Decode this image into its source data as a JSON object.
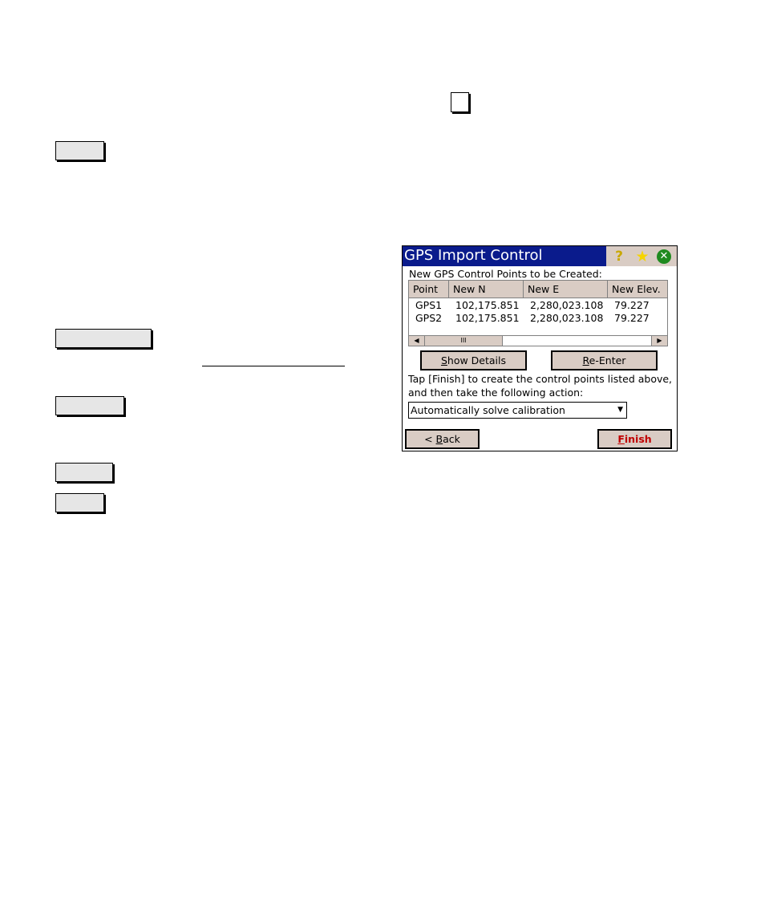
{
  "dialog": {
    "title": "GPS Import Control",
    "icons": [
      "help-icon",
      "favorites-star-icon",
      "close-icon"
    ],
    "colors": {
      "titlebar": "#0a1b8c",
      "button_face": "#d9ccc4",
      "finish_text": "#c00000"
    },
    "section_label": "New GPS Control Points to be Created:",
    "table": {
      "columns": [
        "Point",
        "New N",
        "New E",
        "New Elev."
      ],
      "rows": [
        [
          "GPS1",
          "102,175.851",
          "2,280,023.108",
          "79.227"
        ],
        [
          "GPS2",
          "102,175.851",
          "2,280,023.108",
          "79.227"
        ]
      ],
      "scrollbar": {
        "left_arrow": "◀",
        "thumb_grip": "III",
        "right_arrow": "▶"
      }
    },
    "buttons": {
      "show_details": {
        "mnemonic": "S",
        "rest": "how Details"
      },
      "re_enter": {
        "mnemonic": "R",
        "rest": "e-Enter"
      },
      "back": {
        "prefix": "< ",
        "mnemonic": "B",
        "rest": "ack"
      },
      "finish": {
        "mnemonic": "F",
        "rest": "inish"
      }
    },
    "instruction_line1": "Tap [Finish] to create the control points listed above,",
    "instruction_line2": "and then take the following action:",
    "action_dropdown": {
      "selected": "Automatically solve calibration",
      "arrow": "▼"
    }
  },
  "icons": {
    "help": "?",
    "star": "★",
    "close": "✕"
  }
}
